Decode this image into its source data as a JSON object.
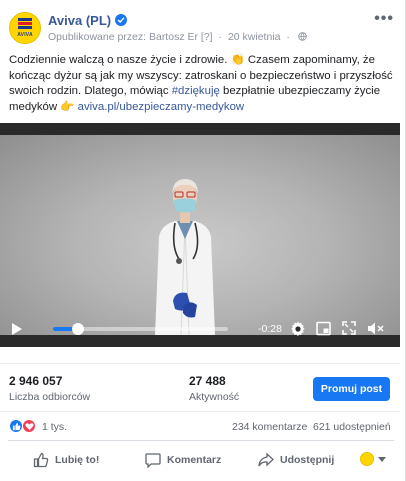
{
  "post": {
    "page_name": "Aviva (PL)",
    "meta_published_by": "Opublikowane przez: Bartosz Er",
    "meta_info_icon": "[?]",
    "meta_dot": "·",
    "meta_date": "20 kwietnia",
    "avatar_logo_text": "AVIVA",
    "more_label": "•••",
    "body_part1": "Codziennie walczą o nasze życie i zdrowie. 👏 Czasem zapominamy, że kończąc dyżur są jak my wszyscy: zatroskani o bezpieczeństwo i przyszłość swoich rodzin. Dlatego, mówiąc ",
    "body_hashtag": "#dziękuję",
    "body_part2": " bezpłatnie ubezpieczamy życie medyków 👉 ",
    "body_link": "aviva.pl/ubezpieczamy-medykow"
  },
  "video": {
    "time_remaining": "-0:28",
    "progress": 0.14
  },
  "stats": {
    "reach_value": "2 946 057",
    "reach_label": "Liczba odbiorców",
    "engagement_value": "27 488",
    "engagement_label": "Aktywność",
    "promote_label": "Promuj post"
  },
  "reactions": {
    "count": "1 tys.",
    "comments": "234 komentarze",
    "shares": "621 udostępnień"
  },
  "actions": {
    "like": "Lubię to!",
    "comment": "Komentarz",
    "share": "Udostępnij"
  },
  "colors": {
    "accent": "#1877f2",
    "link": "#385898",
    "brand_yellow": "#ffd400",
    "love_red": "#f33e58"
  }
}
